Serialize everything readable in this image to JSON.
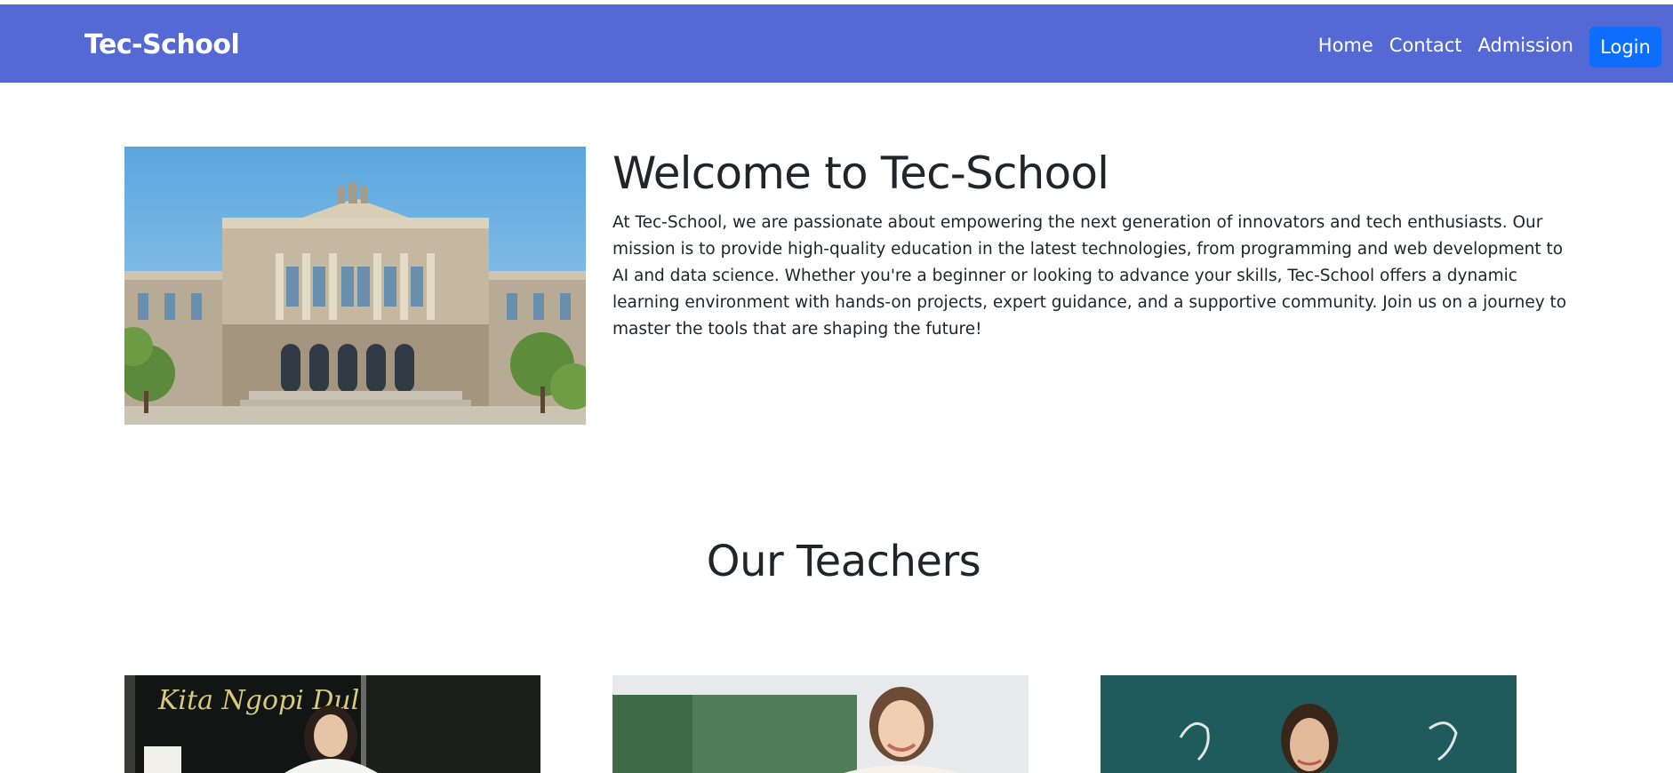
{
  "navbar": {
    "brand": "Tec-School",
    "links": [
      "Home",
      "Contact",
      "Admission"
    ],
    "login_label": "Login",
    "background": "#5469d4",
    "login_color": "#0d6efd"
  },
  "hero": {
    "title": "Welcome to Tec-School",
    "description": "At Tec-School, we are passionate about empowering the next generation of innovators and tech enthusiasts. Our mission is to provide high-quality education in the latest technologies, from programming and web development to AI and data science. Whether you're a beginner or looking to advance your skills, Tec-School offers a dynamic learning environment with hands-on projects, expert guidance, and a supportive community. Join us on a journey to master the tools that are shaping the future!"
  },
  "teachers": {
    "title": "Our Teachers",
    "chalk_text": "Kita Ngopi Dul"
  }
}
